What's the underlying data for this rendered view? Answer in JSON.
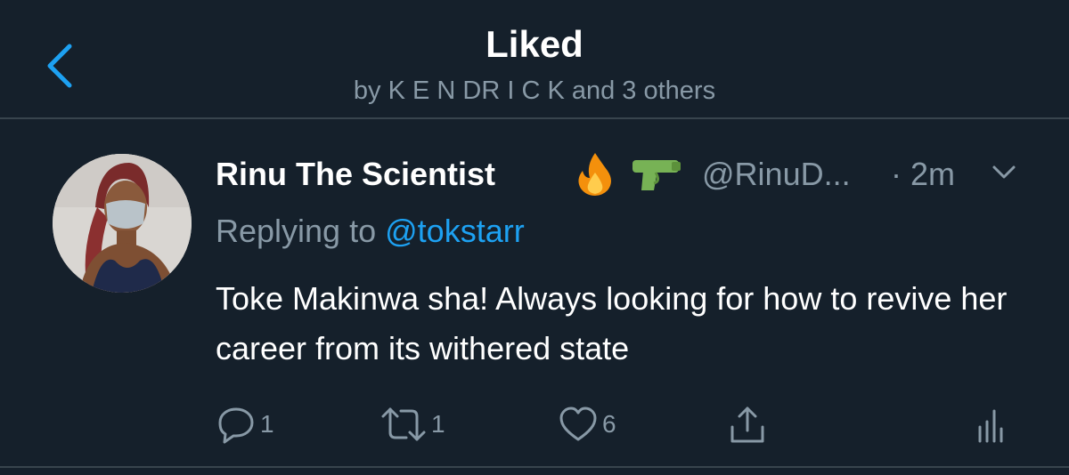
{
  "header": {
    "title": "Liked",
    "subtitle": "by K E N DR I C K and 3 others"
  },
  "tweet": {
    "author_name": "Rinu The Scientist",
    "author_emojis": [
      "fire-emoji",
      "water-pistol-emoji"
    ],
    "handle": "@RinuD...",
    "time": "· 2m",
    "replying_prefix": "Replying to",
    "replying_to": "@tokstarr",
    "text": "Toke Makinwa sha! Always looking for how to revive her career from its withered state",
    "actions": {
      "reply_count": "1",
      "retweet_count": "1",
      "like_count": "6"
    }
  },
  "colors": {
    "background": "#15202b",
    "divider": "#38444d",
    "secondary_text": "#8899a6",
    "accent": "#1da1f2"
  },
  "icons": [
    "back-chevron-icon",
    "chevron-down-icon",
    "reply-icon",
    "retweet-icon",
    "like-icon",
    "share-icon",
    "analytics-icon"
  ]
}
